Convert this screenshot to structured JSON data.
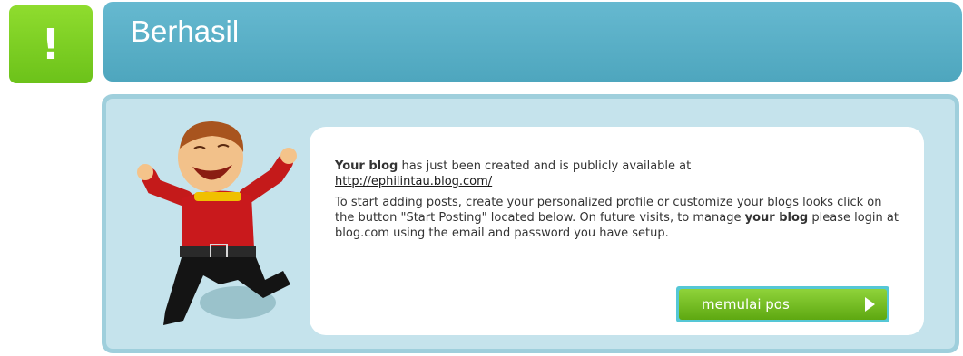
{
  "alert": {
    "glyph": "!"
  },
  "header": {
    "title": "Berhasil"
  },
  "message": {
    "p1_bold": "Your blog",
    "p1_text": " has just been created and is publicly available at",
    "link": "http://ephilintau.blog.com/",
    "p2_a": "To start adding posts, create your personalized profile or customize your blogs looks click on the button \"Start Posting\" located below. On future visits, to manage ",
    "p2_bold": "your blog",
    "p2_b": " please login at blog.com using the email and password you have setup."
  },
  "button": {
    "label": "memulai pos",
    "icon": "play-icon"
  },
  "colors": {
    "accent_green": "#7ed321",
    "header_blue": "#5ab0c7",
    "panel_bg": "#c5e3ec"
  }
}
